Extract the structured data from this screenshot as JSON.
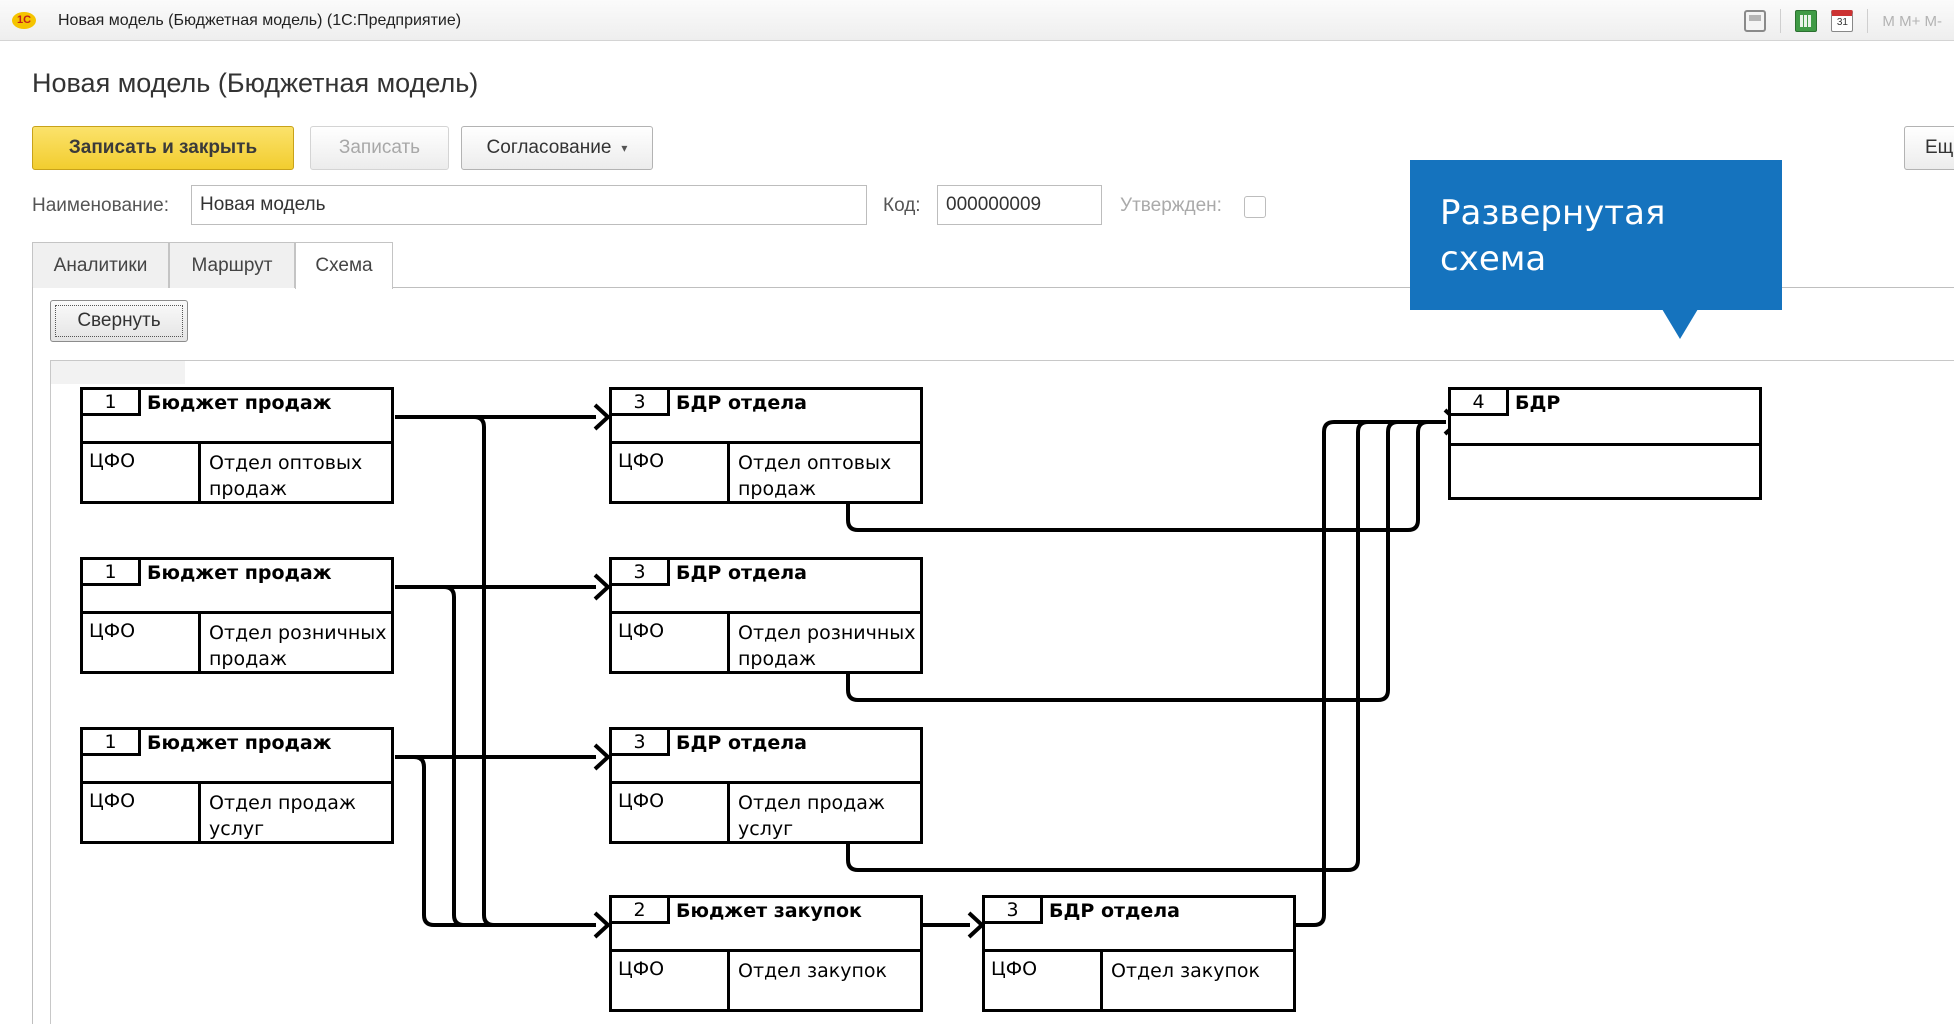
{
  "window": {
    "logo": "1С",
    "title": "Новая модель (Бюджетная модель)  (1С:Предприятие)",
    "memory_buttons": "M  M+  M-",
    "calendar_day": "31"
  },
  "form": {
    "title": "Новая модель (Бюджетная модель)",
    "buttons": {
      "save_close": "Записать и закрыть",
      "save": "Записать",
      "approval": "Согласование",
      "more": "Ещ"
    },
    "fields": {
      "name_label": "Наименование:",
      "name_value": "Новая модель",
      "code_label": "Код:",
      "code_value": "000000009",
      "approved_label": "Утвержден:"
    },
    "tabs": [
      "Аналитики",
      "Маршрут",
      "Схема"
    ],
    "active_tab": "Схема",
    "collapse_button": "Свернуть"
  },
  "diagram": {
    "nodes": [
      {
        "num": "1",
        "name": "Бюджет продаж",
        "cfo_label": "ЦФО",
        "value": "Отдел оптовых продаж"
      },
      {
        "num": "1",
        "name": "Бюджет продаж",
        "cfo_label": "ЦФО",
        "value": "Отдел розничных продаж"
      },
      {
        "num": "1",
        "name": "Бюджет продаж",
        "cfo_label": "ЦФО",
        "value": "Отдел продаж услуг"
      },
      {
        "num": "3",
        "name": "БДР отдела",
        "cfo_label": "ЦФО",
        "value": "Отдел оптовых продаж"
      },
      {
        "num": "3",
        "name": "БДР отдела",
        "cfo_label": "ЦФО",
        "value": "Отдел розничных продаж"
      },
      {
        "num": "3",
        "name": "БДР отдела",
        "cfo_label": "ЦФО",
        "value": "Отдел продаж услуг"
      },
      {
        "num": "2",
        "name": "Бюджет закупок",
        "cfo_label": "ЦФО",
        "value": "Отдел закупок"
      },
      {
        "num": "3",
        "name": "БДР отдела",
        "cfo_label": "ЦФО",
        "value": "Отдел закупок"
      },
      {
        "num": "4",
        "name": "БДР"
      }
    ]
  },
  "callout": {
    "text": "Развернутая схема",
    "color": "#1573be"
  },
  "colors": {
    "primary_button": "#f2cd2f",
    "connector": "#000000"
  }
}
